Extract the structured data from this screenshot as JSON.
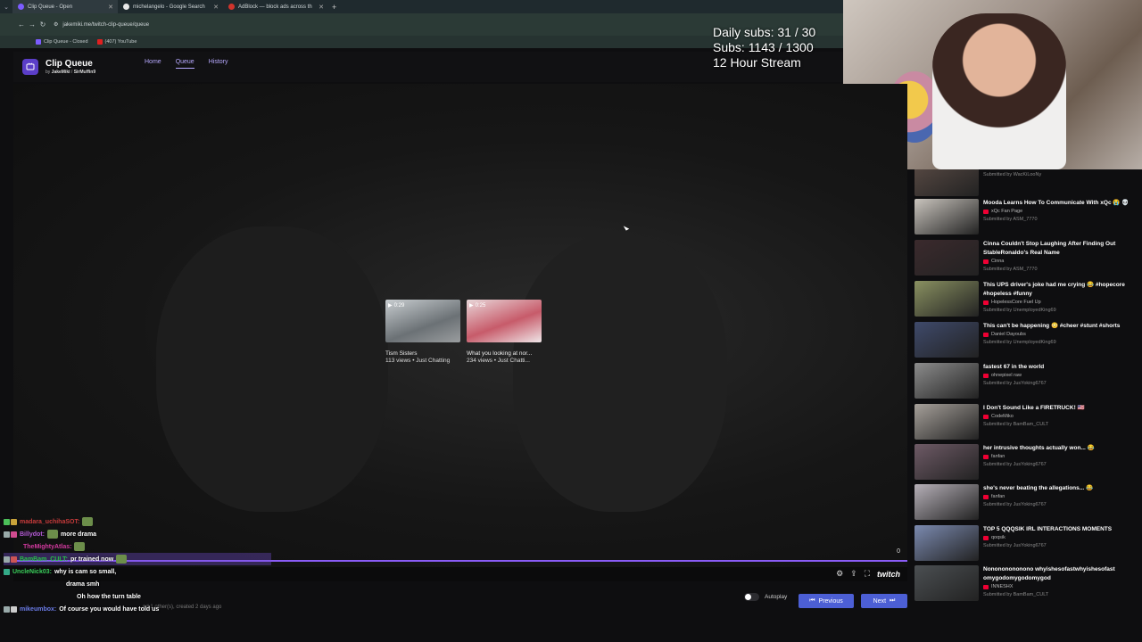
{
  "browser": {
    "tabs": [
      {
        "label": "Clip Queue - Open",
        "favicon_color": "#7c5cff",
        "active": true
      },
      {
        "label": "michelangelo - Google Search",
        "favicon_color": "#e8e8e8",
        "active": false
      },
      {
        "label": "AdBlock — block ads across th",
        "favicon_color": "#d0342c",
        "active": false
      }
    ],
    "url": "jakemiki.me/twitch-clip-queue/queue",
    "bookmarks": [
      {
        "label": "Clip Queue - Closed",
        "color": "#7c5cff"
      },
      {
        "label": "(407) YouTube",
        "color": "#e02020"
      }
    ]
  },
  "overlay": {
    "daily_subs": "Daily subs: 31 / 30",
    "subs": "Subs: 1143 / 1300",
    "stream": "12 Hour Stream"
  },
  "app": {
    "title": "Clip Queue",
    "by": "by",
    "author_1": "JakeMiki",
    "separator": "/",
    "author_2": "SirMuffin9",
    "nav": [
      {
        "label": "Home",
        "active": false
      },
      {
        "label": "Queue",
        "active": true
      },
      {
        "label": "History",
        "active": false
      }
    ]
  },
  "player": {
    "suggestions": [
      {
        "duration": "0:29",
        "title": "Tism Sisters",
        "meta": "113 views • Just Chatting",
        "color": "#8b9296"
      },
      {
        "duration": "0:25",
        "title": "What you looking at nor...",
        "meta": "234 views • Just Chatti...",
        "color": "#c75b6a"
      }
    ],
    "counter": "0",
    "meta_line": "nd 1 other(s), created 2 days ago",
    "autoplay_label": "Autoplay",
    "prev_label": "Previous",
    "next_label": "Next",
    "platform": "twitch"
  },
  "chat": [
    {
      "user": "madara_uchihaSOT:",
      "msg": "",
      "color": "#c93b3b",
      "emote": true
    },
    {
      "user": "Billydot:",
      "msg": "more drama",
      "color": "#b45ad6",
      "emote_before": true
    },
    {
      "user": "TheMightyAtlas:",
      "msg": "",
      "color": "#d43aa0",
      "emote": true
    },
    {
      "user": "BamBam_CULT:",
      "msg": "pr trained now",
      "color": "#27c24a",
      "emote": true,
      "highlight": true
    },
    {
      "user": "UncleNick03:",
      "msg": "why is cam so small,",
      "color": "#3ad05b"
    },
    {
      "user": "",
      "msg": "drama smh",
      "color": "#ffffff"
    },
    {
      "user": "",
      "msg": "Oh how the turn table",
      "color": "#ffffff"
    },
    {
      "user": "mikeumbox:",
      "msg": "Of course you would have told us",
      "color": "#6b7ce8"
    }
  ],
  "queue": [
    {
      "title": "",
      "channel": "",
      "submitter": "Submitted by WacKiLooNy",
      "color": "#5a4b45"
    },
    {
      "title": "Mooda Learns How To Communicate With xQc 😭 💀",
      "channel": "xQc Fan Page",
      "submitter": "Submitted by ASM_7770",
      "color": "#c9c4bd"
    },
    {
      "title": "Cinna Couldn't Stop Laughing After Finding Out StableRonaldo's Real Name",
      "channel": "Cinna",
      "submitter": "Submitted by ASM_7770",
      "color": "#3b2a2d"
    },
    {
      "title": "This UPS driver's joke had me crying 😂 #hopecore #hopeless #funny",
      "channel": "HopelessCore Fuel Up",
      "submitter": "Submitted by UnemployedKing69",
      "color": "#8a9161"
    },
    {
      "title": "This can't be happening 😳 #cheer #stunt #shorts",
      "channel": "Daniel Dayoubs",
      "submitter": "Submitted by UnemployedKing69",
      "color": "#3f4a6b"
    },
    {
      "title": "fastest 67 in the world",
      "channel": "ohnepixel raw",
      "submitter": "Submitted by JusYoking6767",
      "color": "#8c8c8c"
    },
    {
      "title": "I Don't Sound Like a FIRETRUCK! 🇺🇸",
      "channel": "CodeMiko",
      "submitter": "Submitted by BamBam_CULT",
      "color": "#a6a09a"
    },
    {
      "title": "her intrusive thoughts actually won... 😂",
      "channel": "fanfan",
      "submitter": "Submitted by JusYoking6767",
      "color": "#6e5a66"
    },
    {
      "title": "she's never beating the allegations... 😂",
      "channel": "fanfan",
      "submitter": "Submitted by JusYoking6767",
      "color": "#b6b0b8"
    },
    {
      "title": "TOP 5 QQQSIK IRL INTERACTIONS MOMENTS",
      "channel": "qoqsik",
      "submitter": "Submitted by JusYoking6767",
      "color": "#7b8ab0"
    },
    {
      "title": "Nonononononono whyishesofastwhyishesofast omygodomygodomygod",
      "channel": "INNESHX",
      "submitter": "Submitted by BamBam_CULT",
      "color": "#4b4f52"
    }
  ]
}
